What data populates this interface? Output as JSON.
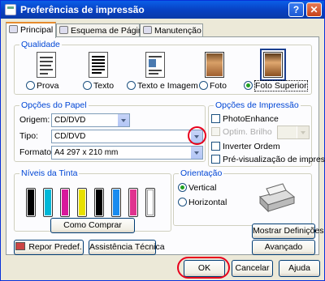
{
  "window": {
    "title": "Preferências de impressão",
    "help": "?",
    "close": "✕"
  },
  "tabs": [
    {
      "label": "Principal",
      "icon": "printer-doc-icon"
    },
    {
      "label": "Esquema de Página",
      "icon": "layout-icon"
    },
    {
      "label": "Manutenção",
      "icon": "tools-icon"
    }
  ],
  "quality": {
    "title": "Qualidade",
    "options": [
      "Prova",
      "Texto",
      "Texto e Imagem",
      "Foto",
      "Foto Superior"
    ],
    "selected": "Foto Superior"
  },
  "paper": {
    "title": "Opções do Papel",
    "origem_label": "Origem:",
    "origem_value": "CD/DVD",
    "tipo_label": "Tipo:",
    "tipo_value": "CD/DVD",
    "formato_label": "Formato:",
    "formato_value": "A4 297 x 210 mm"
  },
  "print_options": {
    "title": "Opções de Impressão",
    "photo_enhance": "PhotoEnhance",
    "optim_brilho": "Optim. Brilho",
    "inverter": "Inverter Ordem",
    "preview": "Pré-visualização de impressão"
  },
  "ink": {
    "title": "Níveis da Tinta",
    "colors": [
      "#000000",
      "#00b8d8",
      "#d8189c",
      "#e8e000",
      "#000000",
      "#1a8cf0",
      "#e0338f",
      "#ffffff"
    ],
    "buy_button": "Como Comprar"
  },
  "orientation": {
    "title": "Orientação",
    "vertical": "Vertical",
    "horizontal": "Horizontal",
    "selected": "Vertical"
  },
  "buttons": {
    "mostrar": "Mostrar Definições",
    "repor": "Repor Predef.",
    "assistencia": "Assistência Técnica",
    "avancado": "Avançado",
    "ok": "OK",
    "cancelar": "Cancelar",
    "ajuda": "Ajuda"
  },
  "accent": {
    "highlight": "#e8001c",
    "group_title": "#0046d5"
  }
}
